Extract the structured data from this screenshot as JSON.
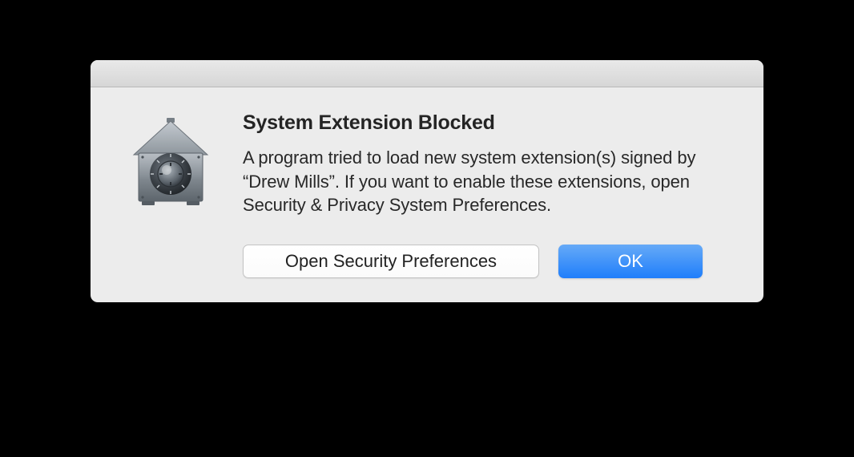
{
  "dialog": {
    "title": "System Extension Blocked",
    "message": "A program tried to load new system extension(s) signed by “Drew Mills”.  If you want to enable these extensions, open Security & Privacy System Preferences.",
    "buttons": {
      "secondary_label": "Open Security Preferences",
      "primary_label": "OK"
    }
  }
}
